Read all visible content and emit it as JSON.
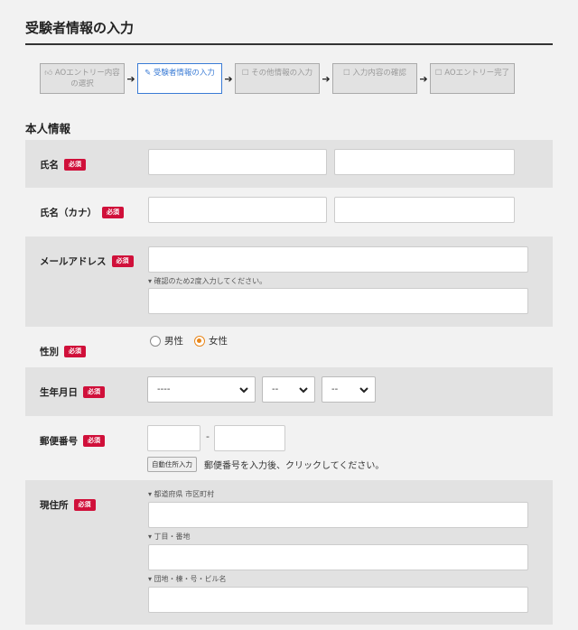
{
  "page": {
    "title": "受験者情報の入力",
    "section_title": "本人情報"
  },
  "steps": [
    {
      "label": "AOエントリー内容の選択",
      "icon": "thumbs-up-icon",
      "active": false
    },
    {
      "label": "受験者情報の入力",
      "icon": "edit-icon",
      "active": true
    },
    {
      "label": "その他情報の入力",
      "icon": "checkbox-icon",
      "active": false
    },
    {
      "label": "入力内容の確認",
      "icon": "checkbox-icon",
      "active": false
    },
    {
      "label": "AOエントリー完了",
      "icon": "checkbox-icon",
      "active": false
    }
  ],
  "step_arrow": "➔",
  "required_badge": "必須",
  "form": {
    "name": {
      "label": "氏名"
    },
    "kana": {
      "label": "氏名（カナ）"
    },
    "email": {
      "label": "メールアドレス",
      "confirm_note": "▾ 確認のため2度入力してください。"
    },
    "gender": {
      "label": "性別",
      "options": [
        "男性",
        "女性"
      ],
      "selected": "女性"
    },
    "birthdate": {
      "label": "生年月日",
      "year": "----",
      "month": "--",
      "day": "--"
    },
    "postal": {
      "label": "郵便番号",
      "separator": "-",
      "autofill_button": "自動住所入力",
      "hint": "郵便番号を入力後、クリックしてください。"
    },
    "address": {
      "label": "現住所",
      "sub_labels": [
        "▾ 都道府県 市区町村",
        "▾ 丁目・番地",
        "▾ 団地・棟・号・ビル名"
      ]
    }
  }
}
